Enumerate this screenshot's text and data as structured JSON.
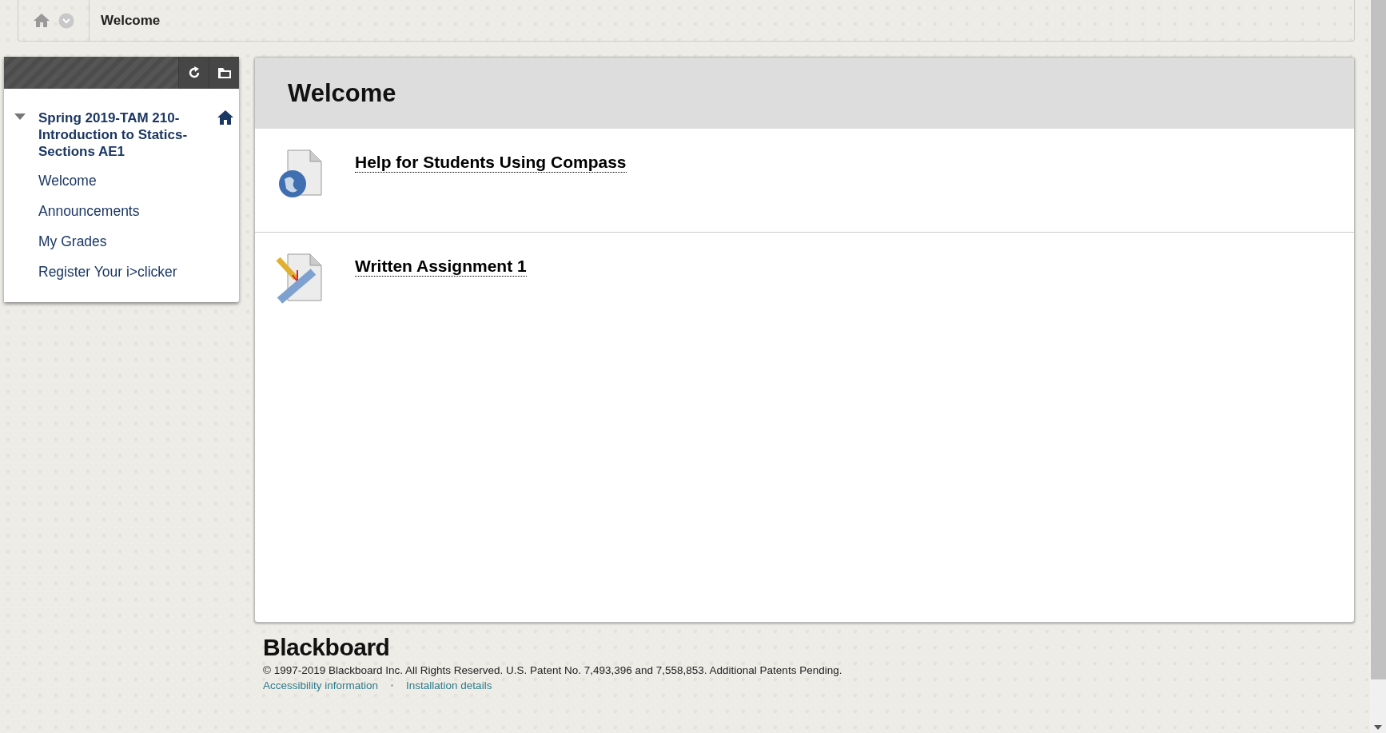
{
  "breadcrumb": {
    "current": "Welcome"
  },
  "course_menu": {
    "course": {
      "title": "Spring 2019-TAM 210-Introduction to Statics-Sections AE1",
      "expanded": true
    },
    "items": [
      {
        "label": "Welcome"
      },
      {
        "label": "Announcements"
      },
      {
        "label": "My Grades"
      },
      {
        "label": "Register Your i>clicker"
      }
    ]
  },
  "content": {
    "title": "Welcome",
    "items": [
      {
        "kind": "link",
        "title": "Help for Students Using Compass"
      },
      {
        "kind": "assignment",
        "title": "Written Assignment 1"
      }
    ]
  },
  "footer": {
    "logo": "Blackboard",
    "copyright": "© 1997-2019 Blackboard Inc. All Rights Reserved. U.S. Patent No. 7,493,396 and 7,558,853. Additional Patents Pending.",
    "links": [
      "Accessibility information",
      "Installation details"
    ]
  }
}
